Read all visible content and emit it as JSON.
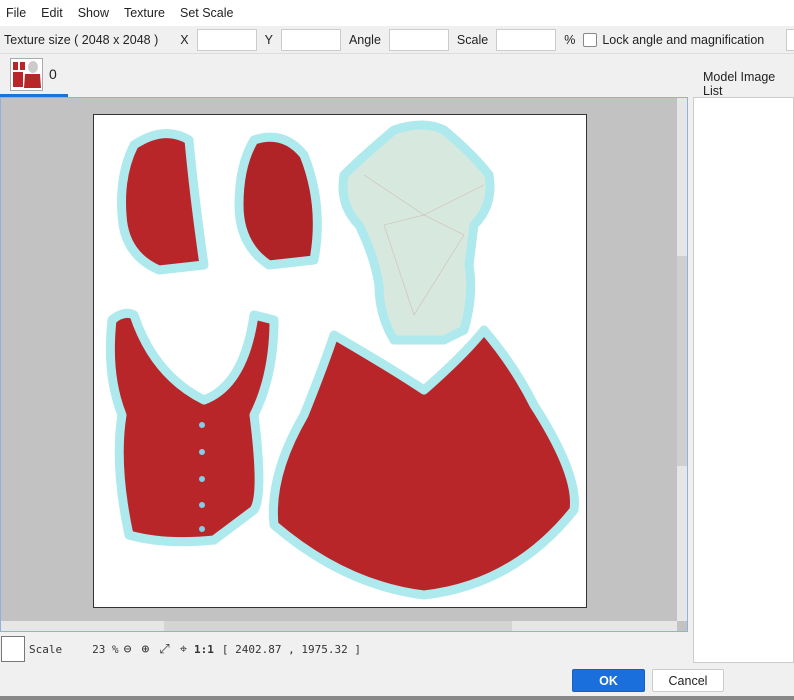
{
  "menu": [
    "File",
    "Edit",
    "Show",
    "Texture",
    "Set Scale"
  ],
  "toolbar": {
    "texture_size": "Texture size ( 2048 x 2048 )",
    "x_label": "X",
    "x_value": "",
    "y_label": "Y",
    "y_value": "",
    "angle_label": "Angle",
    "angle_value": "",
    "scale_label": "Scale",
    "scale_value": "",
    "percent": "%",
    "lock_label": "Lock angle and magnification",
    "lock_checked": false
  },
  "tabs": [
    {
      "label": "0",
      "active": true
    }
  ],
  "right_panel": {
    "title": "Model Image List"
  },
  "status": {
    "scale_label": "Scale",
    "zoom": "23 %",
    "one_to_one": "1:1",
    "coords": "[ 2402.87 , 1975.32 ]"
  },
  "buttons": {
    "ok": "OK",
    "cancel": "Cancel"
  },
  "colors": {
    "accent": "#1a6fdc",
    "garment": "#b8262a",
    "outline": "#aee9ee"
  }
}
